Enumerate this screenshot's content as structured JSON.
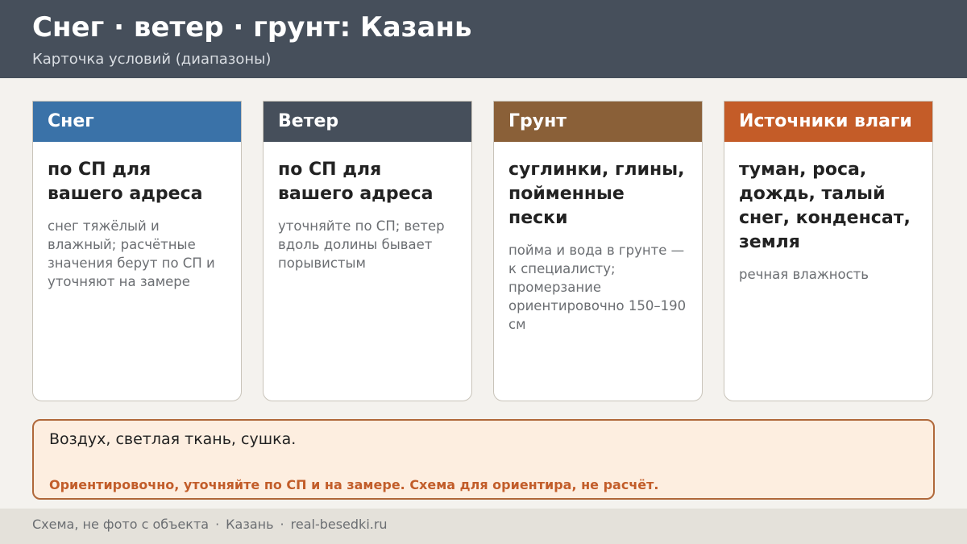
{
  "header": {
    "title": "Снег · ветер · грунт: Казань",
    "subtitle": "Карточка условий (диапазоны)"
  },
  "cards": [
    {
      "title": "Снег",
      "value": "по СП для вашего адреса",
      "note": "снег тяжёлый и влажный; расчётные значения берут по СП и уточняют на замере",
      "color": "#3a72a8"
    },
    {
      "title": "Ветер",
      "value": "по СП для вашего адреса",
      "note": "уточняйте по СП; ветер вдоль долины бывает порывистым",
      "color": "#464f5b"
    },
    {
      "title": "Грунт",
      "value": "суглинки, глины, пойменные пески",
      "note": "пойма и вода в грунте — к специалисту; промерзание ориентировочно 150–190 см",
      "color": "#8a6038"
    },
    {
      "title": "Источники влаги",
      "value": "туман, роса, дождь, талый снег, конденсат, земля",
      "note": "речная влажность",
      "color": "#c45c28"
    }
  ],
  "notebox": {
    "text": "Воздух, светлая ткань, сушка.",
    "warning": "Ориентировочно, уточняйте по СП и на замере. Схема для ориентира, не расчёт."
  },
  "footer": {
    "items": [
      "Схема, не фото с объекта",
      "Казань",
      "real-besedki.ru"
    ],
    "separator": "·"
  }
}
